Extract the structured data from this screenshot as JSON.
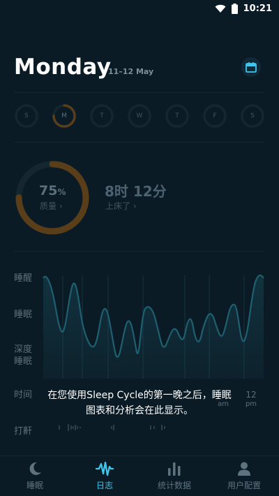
{
  "status": {
    "time": "10:21"
  },
  "header": {
    "day": "Monday",
    "date_range": "11–12 May"
  },
  "week": {
    "days": [
      {
        "letter": "S"
      },
      {
        "letter": "M"
      },
      {
        "letter": "T"
      },
      {
        "letter": "W"
      },
      {
        "letter": "T"
      },
      {
        "letter": "F"
      },
      {
        "letter": "S"
      }
    ],
    "selected_index": 1,
    "selected_quality_percent": 75
  },
  "summary": {
    "quality_number": "75",
    "quality_unit": "%",
    "quality_label": "质量 ›",
    "quality_fraction": 0.75,
    "duration": "8时 12分",
    "duration_label": "上床了 ›"
  },
  "graph": {
    "y_labels": {
      "awake": "睡醒",
      "sleep": "睡眠",
      "deep": "深度\n睡眠"
    },
    "time_label": "时间",
    "time_end": {
      "hour": "12",
      "meridiem": "pm"
    },
    "time_am": "am",
    "snore_label": "打鼾",
    "empty_message_line1": "在您使用Sleep Cycle的第一晚之后，睡眠",
    "empty_message_line2": "图表和分析会在此显示。"
  },
  "colors": {
    "accent": "#3fc7ee",
    "ring": "#5a3e1a",
    "ring_track": "#14262f",
    "curve": "#1a4f5f",
    "background": "#0b1b25"
  },
  "tabs": [
    {
      "label": "睡眠",
      "icon": "moon-icon"
    },
    {
      "label": "日志",
      "icon": "pulse-icon",
      "active": true
    },
    {
      "label": "统计数据",
      "icon": "bar-chart-icon"
    },
    {
      "label": "用户配置",
      "icon": "person-icon"
    }
  ]
}
